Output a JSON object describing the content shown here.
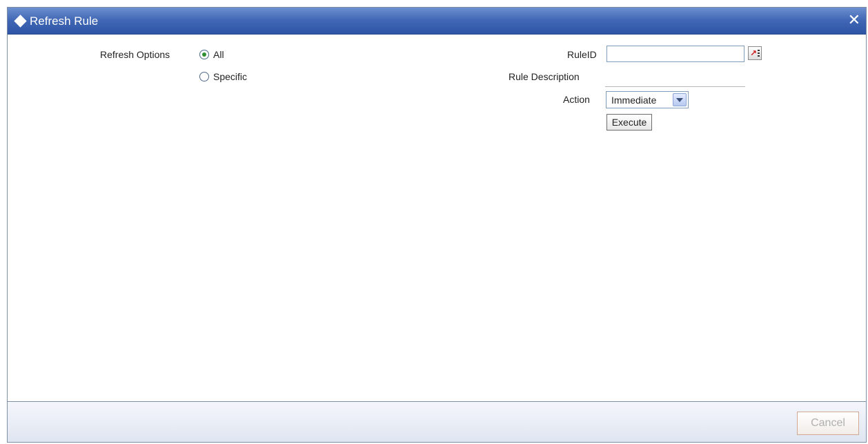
{
  "window": {
    "title": "Refresh Rule"
  },
  "refresh_options": {
    "label": "Refresh Options",
    "options": [
      "All",
      "Specific"
    ],
    "selected": "All"
  },
  "rule_id": {
    "label": "RuleID",
    "value": ""
  },
  "rule_description": {
    "label": "Rule Description",
    "value": ""
  },
  "action": {
    "label": "Action",
    "selected": "Immediate"
  },
  "buttons": {
    "execute": "Execute",
    "cancel": "Cancel"
  },
  "icons": {
    "close": "close-icon",
    "title": "diamond-icon",
    "lov": "lov-search-icon"
  },
  "colors": {
    "titlebar": "#3f66b4",
    "radio_selected": "#2f8f2f",
    "lov_arrow": "#cc1b1b"
  }
}
